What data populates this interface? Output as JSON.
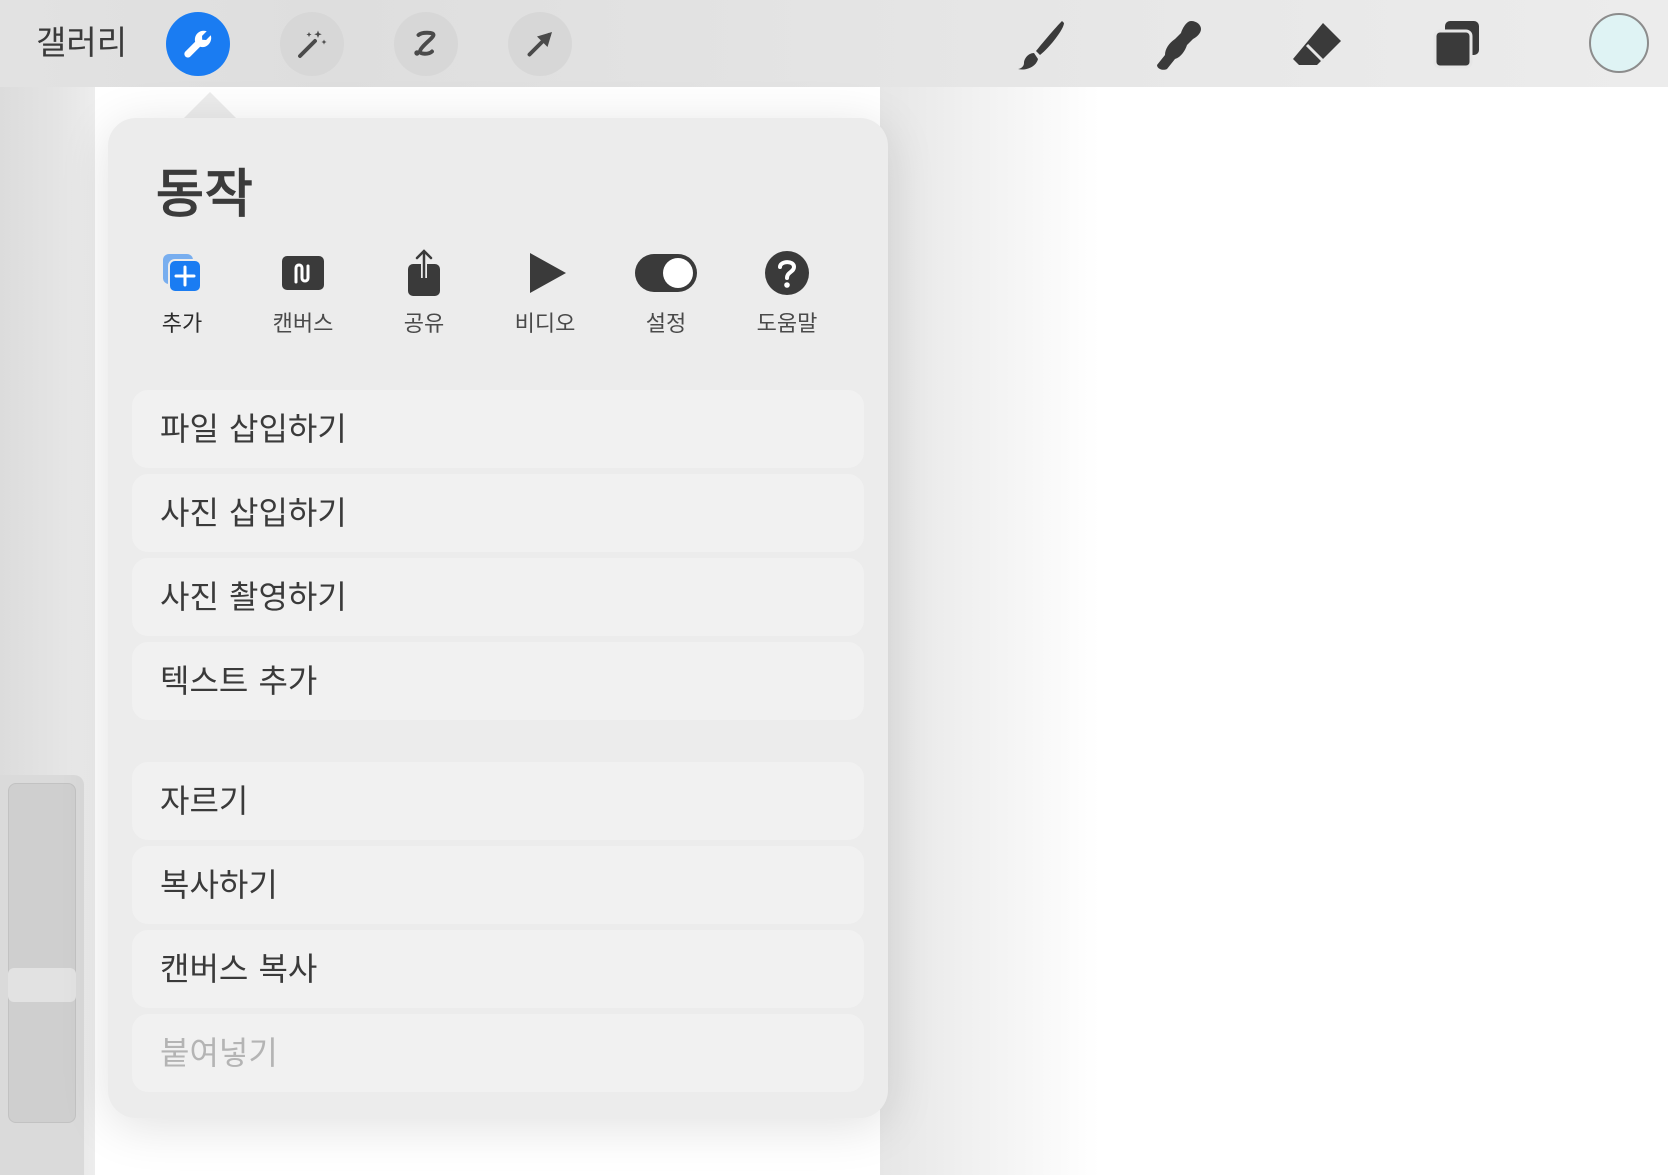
{
  "toolbar": {
    "gallery_label": "갤러리",
    "left_tools": [
      {
        "icon": "wrench-icon",
        "active": true
      },
      {
        "icon": "magic-wand-icon",
        "active": false
      },
      {
        "icon": "selection-icon",
        "active": false
      },
      {
        "icon": "transform-arrow-icon",
        "active": false
      }
    ],
    "right_tools": [
      "brush-icon",
      "smudge-icon",
      "eraser-icon",
      "layers-icon"
    ],
    "current_color": "#dff3f4",
    "accent_color": "#1a7cf2"
  },
  "actions_popover": {
    "title": "동작",
    "tabs": [
      {
        "label": "추가",
        "icon": "add-icon",
        "active": true
      },
      {
        "label": "캔버스",
        "icon": "canvas-icon",
        "active": false
      },
      {
        "label": "공유",
        "icon": "share-icon",
        "active": false
      },
      {
        "label": "비디오",
        "icon": "play-icon",
        "active": false
      },
      {
        "label": "설정",
        "icon": "toggle-icon",
        "active": false
      },
      {
        "label": "도움말",
        "icon": "help-icon",
        "active": false
      }
    ],
    "menu_group_1": [
      {
        "label": "파일 삽입하기",
        "enabled": true
      },
      {
        "label": "사진 삽입하기",
        "enabled": true
      },
      {
        "label": "사진 촬영하기",
        "enabled": true
      },
      {
        "label": "텍스트 추가",
        "enabled": true
      }
    ],
    "menu_group_2": [
      {
        "label": "자르기",
        "enabled": true
      },
      {
        "label": "복사하기",
        "enabled": true
      },
      {
        "label": "캔버스 복사",
        "enabled": true
      },
      {
        "label": "붙여넣기",
        "enabled": false
      }
    ]
  }
}
